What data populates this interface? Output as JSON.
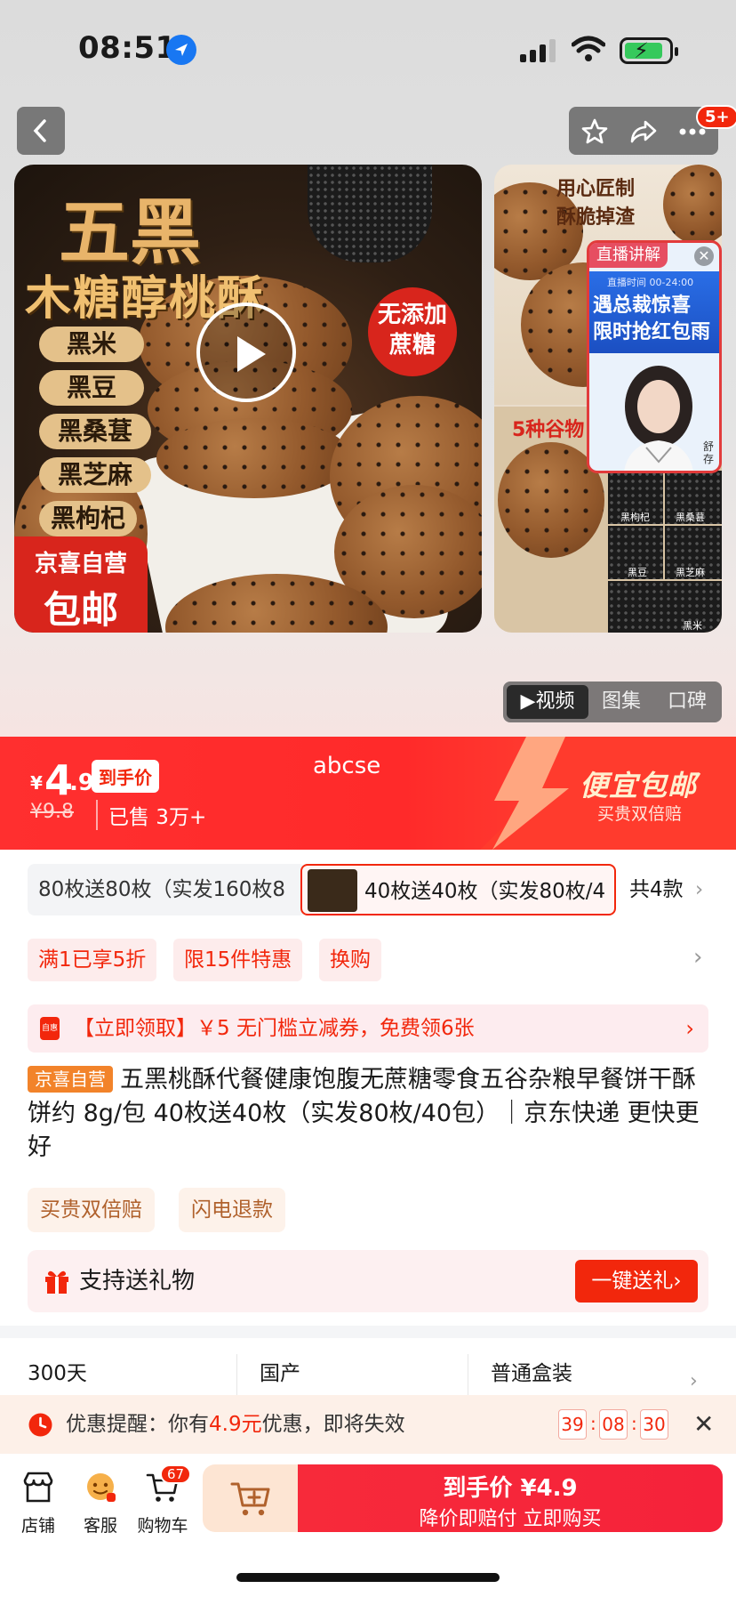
{
  "status_bar": {
    "time": "08:51"
  },
  "nav": {
    "cart_count_badge": "5+"
  },
  "main_image": {
    "title_top": "五黑",
    "title_main": "木糖醇桃酥",
    "ingredients": [
      "黑米",
      "黑豆",
      "黑桑葚",
      "黑芝麻",
      "黑枸杞"
    ],
    "no_sugar_badge": "无添加蔗糖",
    "store_badge_line1": "京喜自营",
    "store_badge_line2": "包邮"
  },
  "side_image": {
    "caption": "用心匠制\n酥脆掉渣",
    "grains_caption": "5种谷物",
    "grain_labels": [
      "黑枸杞",
      "黑桑葚",
      "黑豆",
      "黑芝麻",
      "黑米"
    ]
  },
  "live": {
    "tag": "直播讲解",
    "banner_text": "遇总裁惊喜\n限时抢红包雨",
    "banner_sub": "直播时间 00-24:00",
    "host_sub": "舒\n存"
  },
  "media_tabs": [
    "▶视频",
    "图集",
    "口碑"
  ],
  "price": {
    "currency": "¥",
    "int": "4",
    "dec": ".9",
    "daoshou_label": "到手价",
    "old_price": "¥9.8",
    "sold": "已售 3万+",
    "watermark": "abcse",
    "promo_title": "便宜包邮",
    "promo_sub": "买贵双倍赔"
  },
  "specs": {
    "option1": "80枚送80枚（实发160枚8",
    "option2": "40枚送40枚（实发80枚/4",
    "total": "共4款"
  },
  "promos": [
    "满1已享5折",
    "限15件特惠",
    "换购"
  ],
  "coupon": {
    "icon_label": "自惠",
    "text": "【立即领取】￥5 无门槛立减券，免费领6张"
  },
  "product": {
    "store_tag": "京喜自营",
    "title": "五黑桃酥代餐健康饱腹无蔗糖零食五谷杂粮早餐饼干酥饼约 8g/包 40枚送40枚（实发80枚/40包）｜京东快递 更快更好"
  },
  "services": [
    "买贵双倍赔",
    "闪电退款"
  ],
  "gift": {
    "label": "支持送礼物",
    "button": "一键送礼›"
  },
  "params": [
    "300天",
    "国产",
    "普通盒装"
  ],
  "reminder": {
    "prefix": "优惠提醒：你有",
    "amount": "4.9元",
    "suffix": "优惠，即将失效",
    "hh": "39",
    "mm": "08",
    "ss": "30"
  },
  "bottom_bar": {
    "store": "店铺",
    "service": "客服",
    "cart": "购物车",
    "cart_badge": "67",
    "buy_line1": "到手价 ¥4.9",
    "buy_line2": "降价即赔付 立即购买"
  },
  "colors": {
    "accent_red": "#f2270c",
    "store_orange": "#f2832a"
  }
}
